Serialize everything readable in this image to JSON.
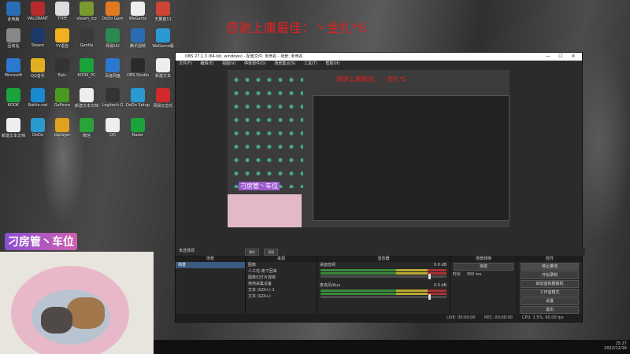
{
  "overlay_text": "感谢上庸最佳：丶金扎*S",
  "camera_sign": "刁房管丶车位",
  "desktop_icons": [
    {
      "label": "此电脑",
      "color": "#2a6db5"
    },
    {
      "label": "VALORANT",
      "color": "#b52a2a"
    },
    {
      "label": "TYPE",
      "color": "#ddd"
    },
    {
      "label": "steam_ico",
      "color": "#7a9a30"
    },
    {
      "label": "DoDo Gam",
      "color": "#e07a20"
    },
    {
      "label": "WeGame",
      "color": "#eee"
    },
    {
      "label": "天翼盘11",
      "color": "#c43"
    },
    {
      "label": "回收站",
      "color": "#888"
    },
    {
      "label": "Steam",
      "color": "#1b3a6a"
    },
    {
      "label": "YY语音",
      "color": "#f0b020"
    },
    {
      "label": "Gentle",
      "color": "#3a3a3a"
    },
    {
      "label": "网易UU",
      "color": "#2a8a50"
    },
    {
      "label": "腾讯视频",
      "color": "#2a6db5"
    },
    {
      "label": "WeGame版",
      "color": "#2a9ad0"
    },
    {
      "label": "Microsoft",
      "color": "#2a78d0"
    },
    {
      "label": "QQ音乐",
      "color": "#e0b020"
    },
    {
      "label": "Epic",
      "color": "#333"
    },
    {
      "label": "KOOK_PC",
      "color": "#1aa33a"
    },
    {
      "label": "百度网盘",
      "color": "#2a78d0"
    },
    {
      "label": "OBS Studio",
      "color": "#2a2a2a"
    },
    {
      "label": "新建文本",
      "color": "#eee"
    },
    {
      "label": "KOOK",
      "color": "#1aa33a"
    },
    {
      "label": "Battle.net",
      "color": "#1a8ad0"
    },
    {
      "label": "GeForce",
      "color": "#4a9a20"
    },
    {
      "label": "新建文本文档",
      "color": "#eee"
    },
    {
      "label": "Logitech G",
      "color": "#333"
    },
    {
      "label": "DoDo Setup",
      "color": "#2a9ad0"
    },
    {
      "label": "网易云音乐",
      "color": "#d02a2a"
    },
    {
      "label": "新建文本文档",
      "color": "#eee"
    },
    {
      "label": "DoDo",
      "color": "#2a9ad0"
    },
    {
      "label": "idplayer",
      "color": "#e0a020"
    },
    {
      "label": "微信",
      "color": "#2aa33a"
    },
    {
      "label": "QQ",
      "color": "#eee"
    },
    {
      "label": "Razer",
      "color": "#1aa33a"
    }
  ],
  "window": {
    "title": "OBS 27.1.3 (64-bit, windows) - 配置文件: 未命名 - 场景: 未命名",
    "minimize": "—",
    "maximize": "☐",
    "close": "✕",
    "menu": [
      "文件(F)",
      "编辑(E)",
      "视图(V)",
      "停靠部件(D)",
      "场景集合(S)",
      "工具(T)",
      "帮助(H)"
    ],
    "preview_overlay": "感谢上庸最佳：丶金扎*S",
    "preview_sign": "刁房管丶车位"
  },
  "scene_bar": {
    "label": "未选择源",
    "properties": "属性",
    "filters": "滤镜"
  },
  "scenes": {
    "header": "场景",
    "items": [
      "场景"
    ],
    "footer": "+ − ∧ ∨"
  },
  "sources": {
    "header": "来源",
    "items": [
      "图像",
      "人工花·南下回来",
      "图像幻灯片放映",
      "使用采集设备",
      "文本 (GDI+) 2",
      "文本 (GDI+)"
    ],
    "footer": "+ − ⚙ ∧ ∨"
  },
  "mixer": {
    "header": "混音器",
    "tracks": [
      {
        "name": "桌面音频",
        "db": "0.0 dB"
      },
      {
        "name": "麦克风/Aux",
        "db": "0.0 dB"
      }
    ]
  },
  "transitions": {
    "header": "场景转换",
    "type": "渐变",
    "duration_label": "时长",
    "duration_value": "300 ms"
  },
  "controls": {
    "header": "控件",
    "buttons": [
      "停止推流",
      "开始录制",
      "启动虚拟摄像机",
      "工作室模式",
      "设置",
      "退出"
    ]
  },
  "status": {
    "live": "LIVE: 00:00:00",
    "rec": "REC: 00:00:00",
    "cpu": "CPU: 1.5%, 60.00 fps"
  },
  "taskbar": {
    "time": "15:27",
    "date": "2022/12/16"
  }
}
